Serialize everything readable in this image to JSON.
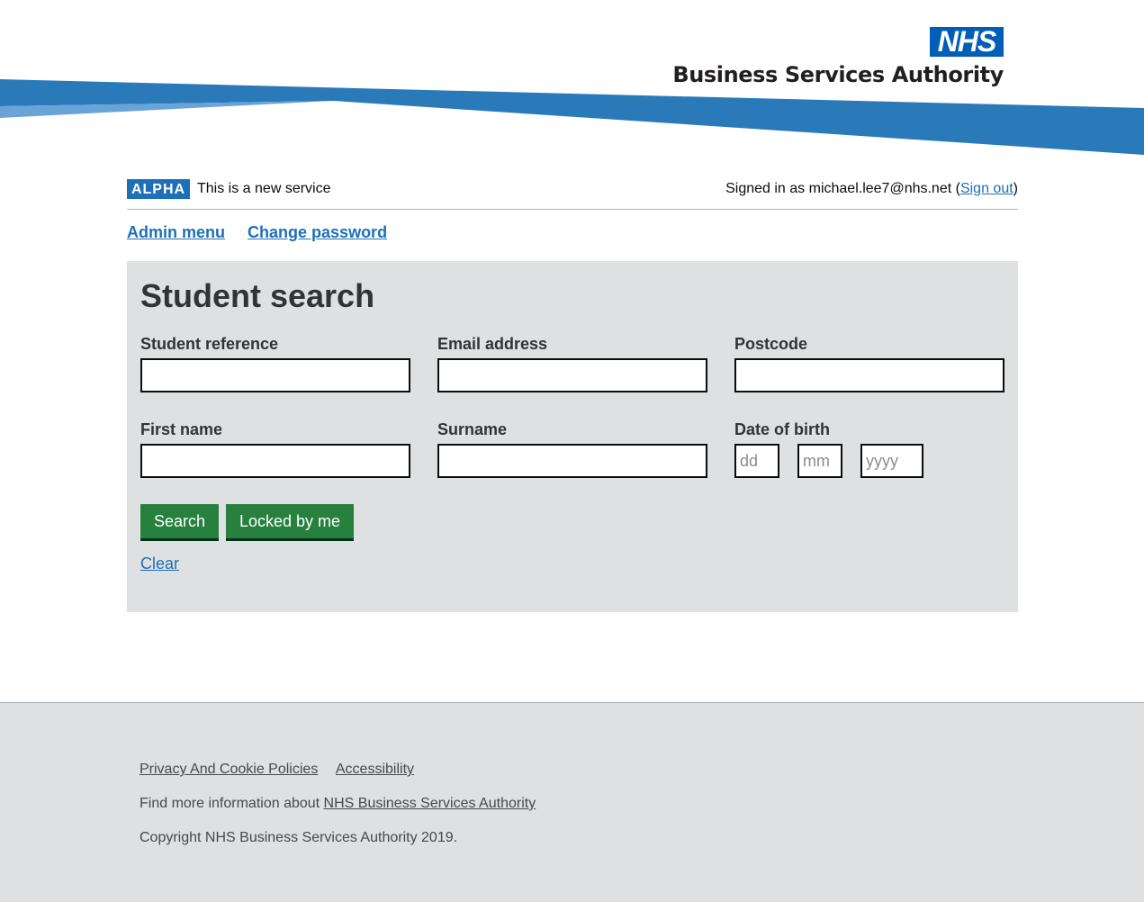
{
  "header": {
    "logo_text": "NHS",
    "org_name": "Business Services Authority"
  },
  "phase_banner": {
    "tag": "ALPHA",
    "text": "This is a new service",
    "signed_in_prefix": "Signed in as michael.lee7@nhs.net (",
    "sign_out_label": "Sign out",
    "signed_in_suffix": ")"
  },
  "nav": {
    "admin_menu": "Admin menu",
    "change_password": "Change password"
  },
  "search": {
    "title": "Student search",
    "fields": {
      "student_reference": {
        "label": "Student reference",
        "value": ""
      },
      "email_address": {
        "label": "Email address",
        "value": ""
      },
      "postcode": {
        "label": "Postcode",
        "value": ""
      },
      "first_name": {
        "label": "First name",
        "value": ""
      },
      "surname": {
        "label": "Surname",
        "value": ""
      }
    },
    "dob": {
      "label": "Date of birth",
      "day_placeholder": "dd",
      "month_placeholder": "mm",
      "year_placeholder": "yyyy"
    },
    "search_button": "Search",
    "locked_button": "Locked by me",
    "clear_link": "Clear"
  },
  "footer": {
    "privacy_link": "Privacy And Cookie Policies",
    "accessibility_link": "Accessibility",
    "more_info_prefix": "Find more information about ",
    "more_info_link": "NHS Business Services Authority",
    "copyright": "Copyright NHS Business Services Authority 2019."
  },
  "colors": {
    "nhs_blue": "#005eb8",
    "link_blue": "#1d70b8",
    "button_green": "#28803e",
    "panel_grey": "#dee0e2"
  }
}
